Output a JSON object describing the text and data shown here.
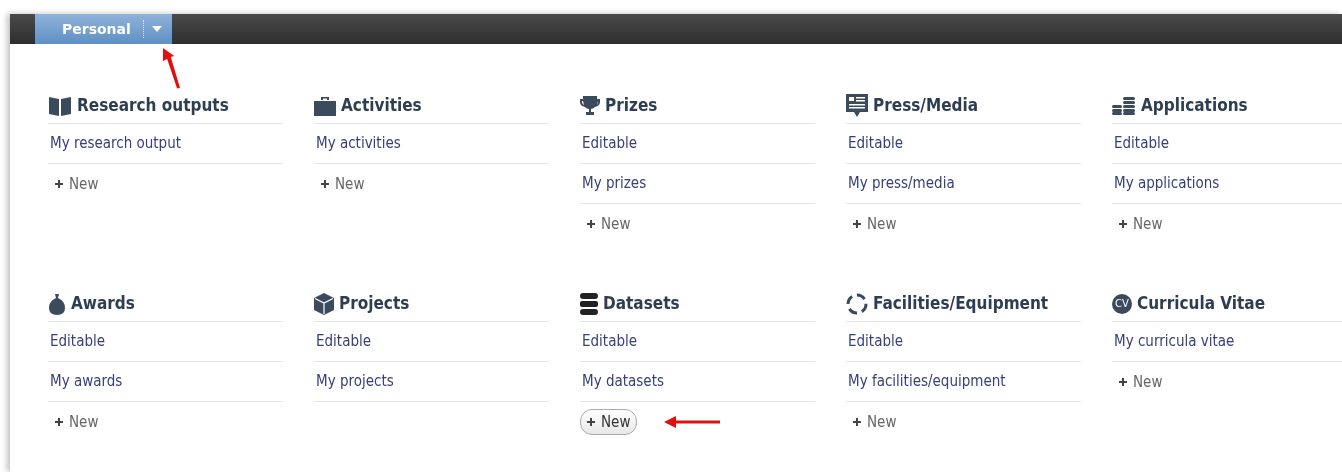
{
  "top_bar": {
    "tab": {
      "label": "Personal",
      "selected": true
    }
  },
  "sections": [
    {
      "title": "Research outputs",
      "links": [
        "My research output"
      ],
      "new": {
        "label": "New",
        "highlighted": false
      }
    },
    {
      "title": "Activities",
      "links": [
        "My activities"
      ],
      "new": {
        "label": "New",
        "highlighted": false
      }
    },
    {
      "title": "Prizes",
      "links": [
        "Editable",
        "My prizes"
      ],
      "new": {
        "label": "New",
        "highlighted": false
      }
    },
    {
      "title": "Press/Media",
      "links": [
        "Editable",
        "My press/media"
      ],
      "new": {
        "label": "New",
        "highlighted": false
      }
    },
    {
      "title": "Applications",
      "links": [
        "Editable",
        "My applications"
      ],
      "new": {
        "label": "New",
        "highlighted": false
      }
    },
    {
      "title": "Awards",
      "links": [
        "Editable",
        "My awards"
      ],
      "new": {
        "label": "New",
        "highlighted": false
      }
    },
    {
      "title": "Projects",
      "links": [
        "Editable",
        "My projects"
      ]
    },
    {
      "title": "Datasets",
      "links": [
        "Editable",
        "My datasets"
      ],
      "new": {
        "label": "New",
        "highlighted": true
      }
    },
    {
      "title": "Facilities/Equipment",
      "links": [
        "Editable",
        "My facilities/equipment"
      ],
      "new": {
        "label": "New",
        "highlighted": false
      }
    },
    {
      "icon_text": "CV",
      "title": "Curricula Vitae",
      "links": [
        "My curricula vitae"
      ],
      "new": {
        "label": "New",
        "highlighted": false
      }
    }
  ]
}
